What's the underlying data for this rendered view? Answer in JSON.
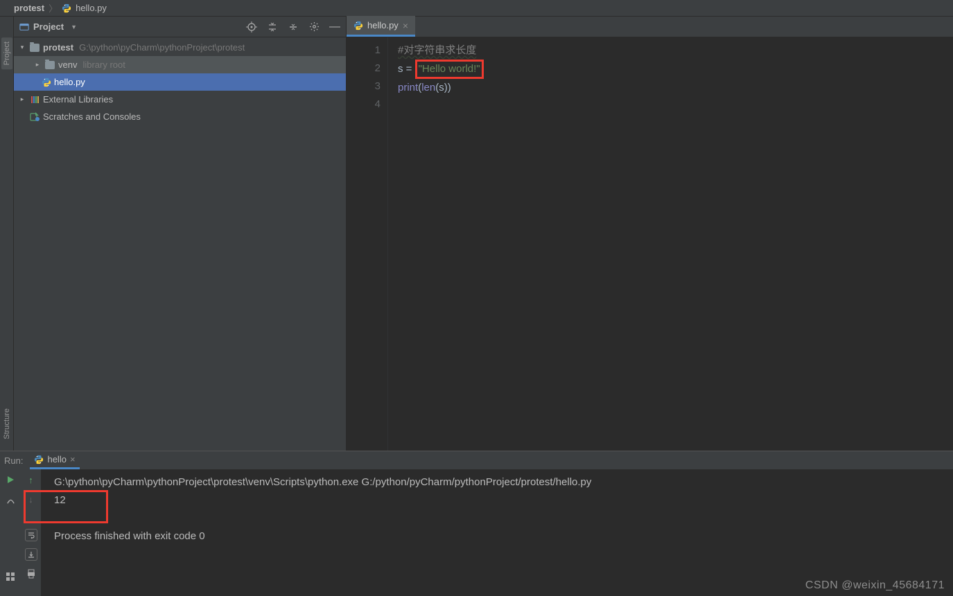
{
  "breadcrumb": {
    "project": "protest",
    "file": "hello.py"
  },
  "project_panel": {
    "title": "Project",
    "root": {
      "name": "protest",
      "path": "G:\\python\\pyCharm\\pythonProject\\protest"
    },
    "venv": {
      "name": "venv",
      "note": "library root"
    },
    "file1": "hello.py",
    "ext_lib": "External Libraries",
    "scratches": "Scratches and Consoles"
  },
  "editor": {
    "tab": "hello.py",
    "lines": {
      "l1_comment": "#对字符串求长度",
      "l2_var": "s",
      "l2_eq": " = ",
      "l2_str": "\"Hello world!\"",
      "l3_print": "print",
      "l3_len": "len",
      "l3_s": "s"
    },
    "gutter": [
      "1",
      "2",
      "3",
      "4"
    ]
  },
  "run": {
    "label": "Run:",
    "tab": "hello",
    "out_cmd": "G:\\python\\pyCharm\\pythonProject\\protest\\venv\\Scripts\\python.exe G:/python/pyCharm/pythonProject/protest/hello.py",
    "out_val": "12",
    "out_done": "Process finished with exit code 0"
  },
  "sidetabs": {
    "project": "Project",
    "structure": "Structure"
  },
  "watermark": "CSDN @weixin_45684171"
}
